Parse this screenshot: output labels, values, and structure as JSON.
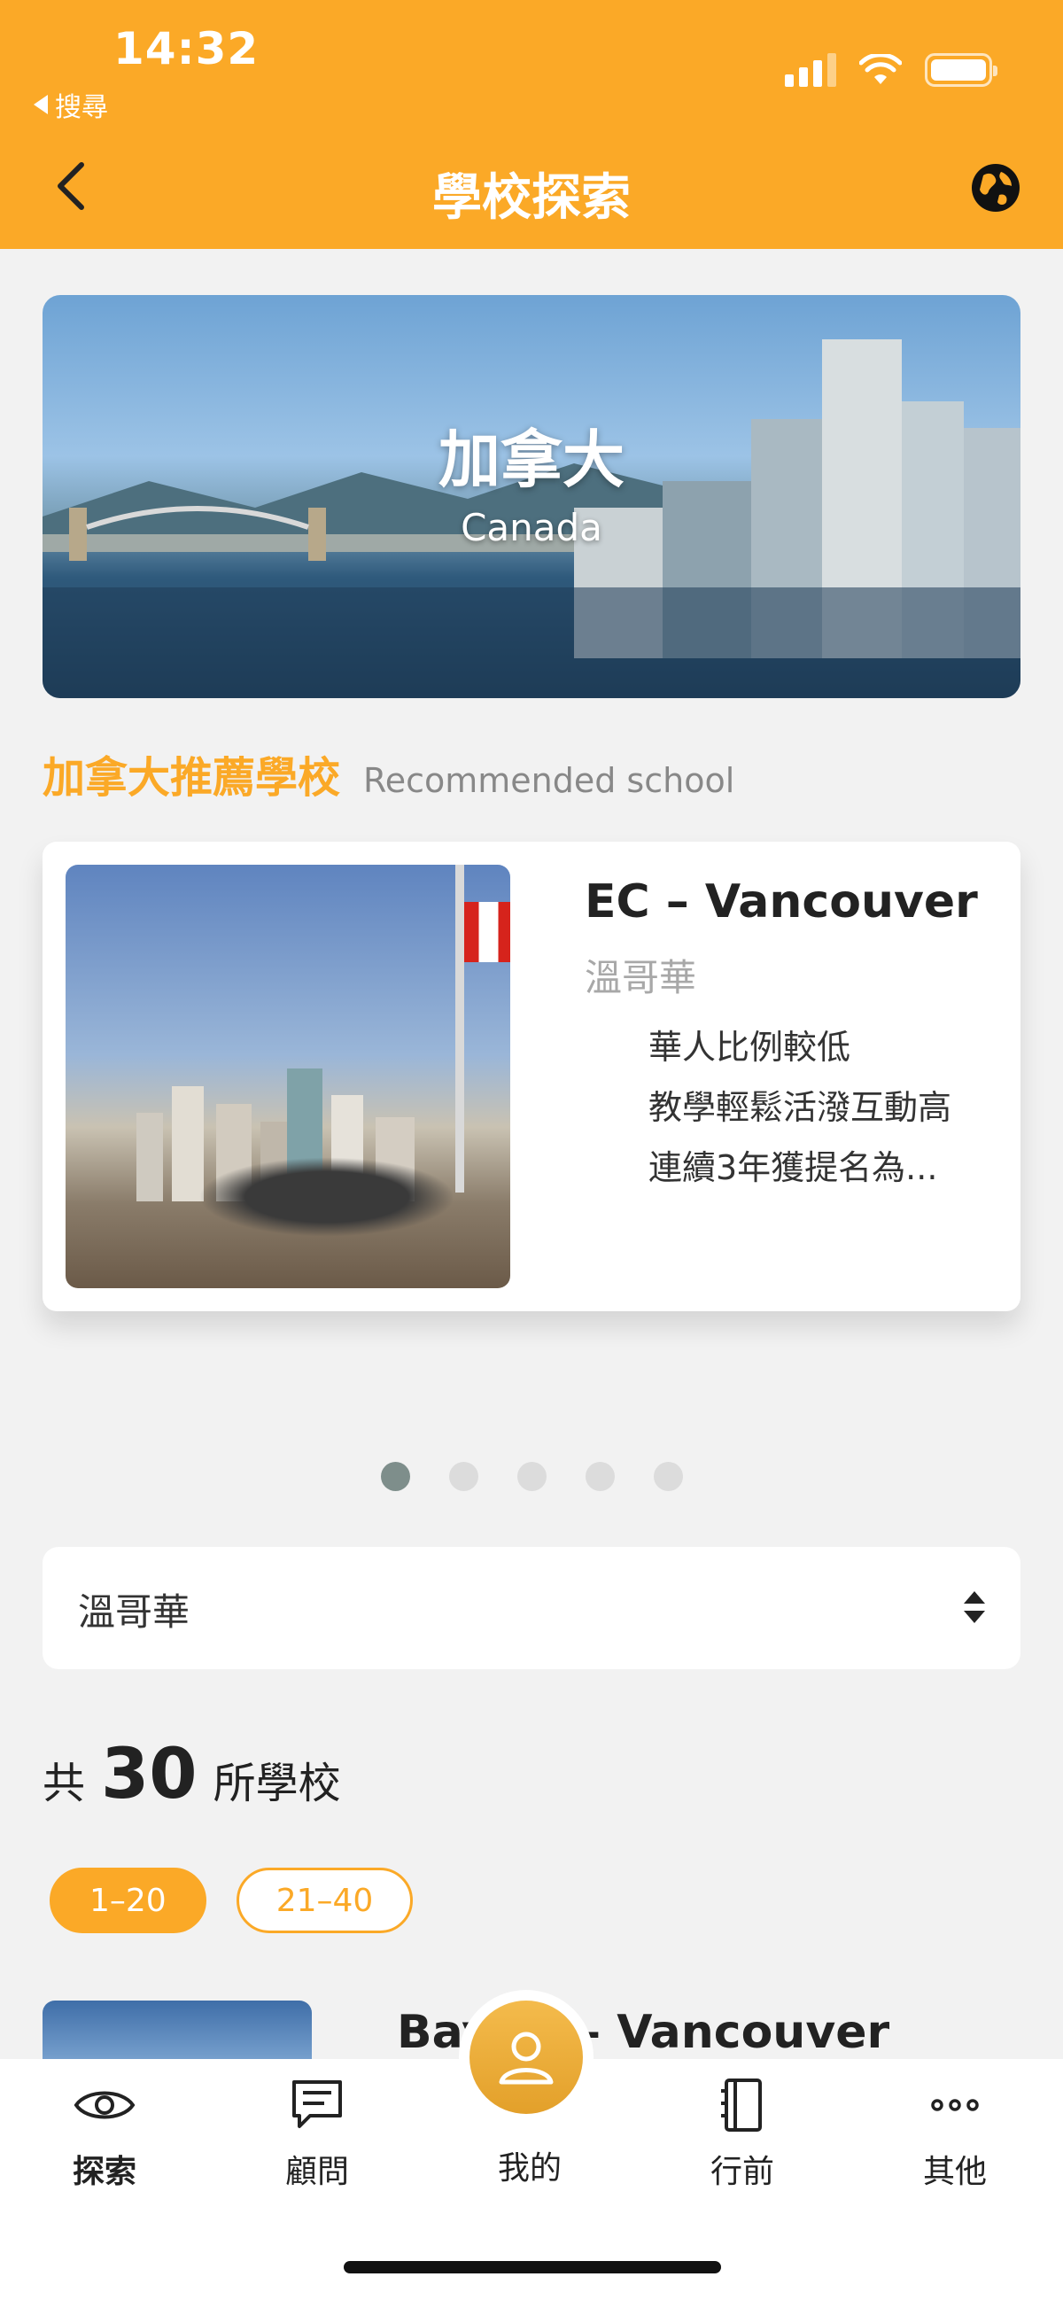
{
  "status": {
    "time": "14:32",
    "back_app": "搜尋"
  },
  "nav": {
    "title": "學校探索"
  },
  "banner": {
    "title_cn": "加拿大",
    "title_en": "Canada"
  },
  "section": {
    "title_cn": "加拿大推薦學校",
    "title_en": "Recommended school"
  },
  "recommended": {
    "name": "EC – Vancouver",
    "city": "溫哥華",
    "features": [
      "華人比例較低",
      "教學輕鬆活潑互動高",
      "連續3年獲提名為..."
    ]
  },
  "pager": {
    "total": 5,
    "active": 1
  },
  "filter": {
    "selected": "溫哥華"
  },
  "count": {
    "prefix": "共",
    "number": "30",
    "suffix": "所學校"
  },
  "pages": [
    {
      "label": "1–20",
      "active": true
    },
    {
      "label": "21–40",
      "active": false
    }
  ],
  "list": [
    {
      "title": "Bay       er – Vancouver"
    }
  ],
  "tabbar": {
    "items": [
      {
        "label": "探索",
        "icon": "eye-icon",
        "active": true
      },
      {
        "label": "顧問",
        "icon": "chat-icon",
        "active": false
      },
      {
        "label": "我的",
        "icon": "user-icon",
        "active": false
      },
      {
        "label": "行前",
        "icon": "notebook-icon",
        "active": false
      },
      {
        "label": "其他",
        "icon": "more-icon",
        "active": false
      }
    ]
  },
  "colors": {
    "accent": "#fba927",
    "background": "#f2f2f2",
    "dot_active": "#7e8e8b",
    "dot_inactive": "#dcdcdc"
  }
}
